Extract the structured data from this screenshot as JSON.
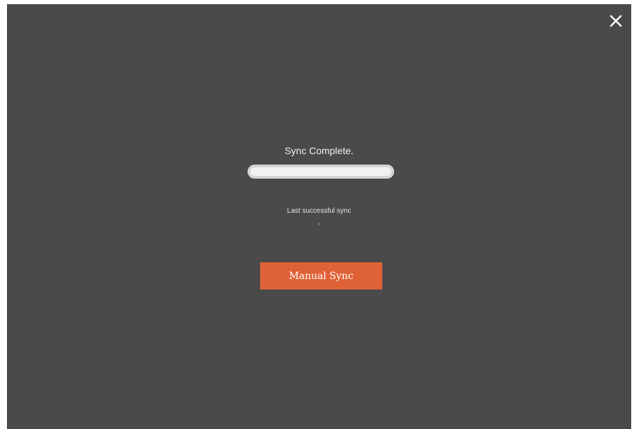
{
  "modal": {
    "close_icon": "close-icon",
    "status_title": "Sync Complete.",
    "progress": {
      "value": 1.0
    },
    "last_sync_label": "Last successful sync",
    "last_sync_value": "-",
    "manual_sync_label": "Manual Sync"
  },
  "colors": {
    "overlay": "#4a4a4a",
    "accent": "#df6236",
    "text": "#f2f2f2"
  }
}
